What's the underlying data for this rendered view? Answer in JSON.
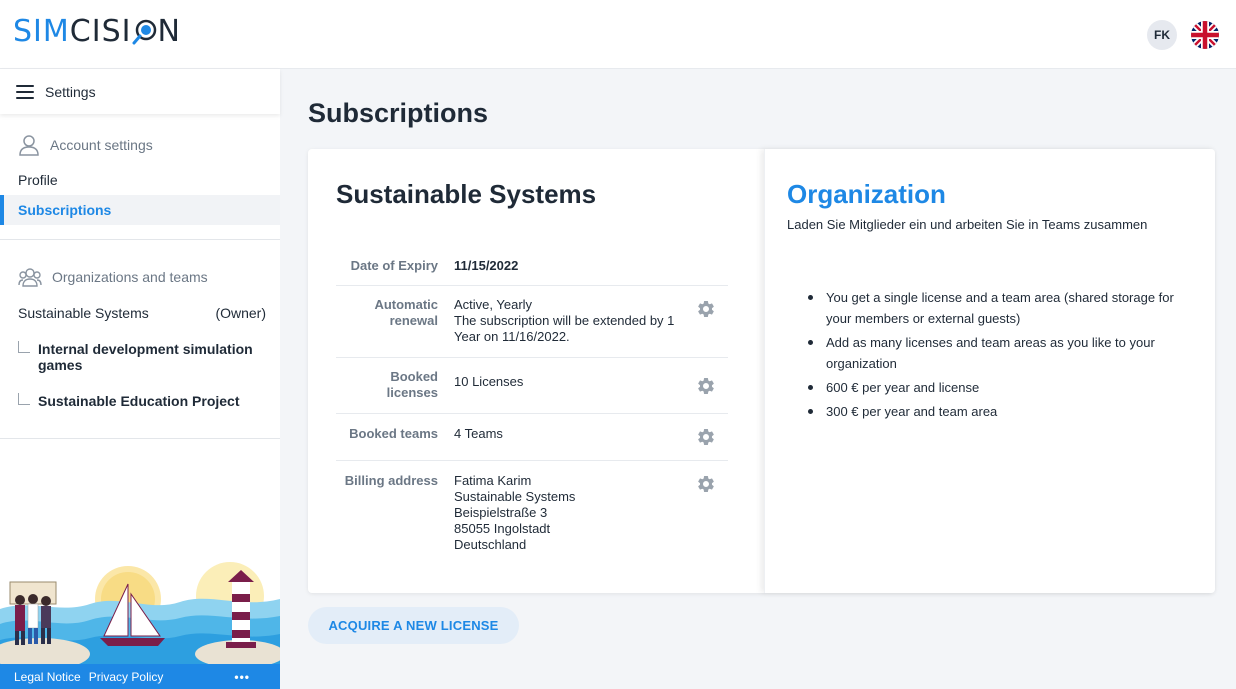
{
  "app": {
    "logo_part1": "SIM",
    "logo_part2": "CISI",
    "logo_part3": "N",
    "user_initials": "FK",
    "language_icon": "uk-flag-icon"
  },
  "sidebar": {
    "menu_label": "Settings",
    "account_section": "Account settings",
    "account_items": [
      {
        "label": "Profile",
        "active": false
      },
      {
        "label": "Subscriptions",
        "active": true
      }
    ],
    "org_section": "Organizations and teams",
    "org_name": "Sustainable Systems",
    "org_role": "(Owner)",
    "teams": [
      "Internal development simulation games",
      "Sustainable Education Project"
    ]
  },
  "footer": {
    "legal": "Legal Notice",
    "privacy": "Privacy Policy",
    "more": "•••"
  },
  "main": {
    "page_title": "Subscriptions",
    "subscription": {
      "name": "Sustainable Systems",
      "rows": [
        {
          "label": "Date of Expiry",
          "value": "11/15/2022"
        },
        {
          "label": "Automatic renewal",
          "value": "Active, Yearly\nThe subscription will be extended by 1 Year on 11/16/2022."
        },
        {
          "label": "Booked licenses",
          "value": "10 Licenses"
        },
        {
          "label": "Booked teams",
          "value": "4 Teams"
        },
        {
          "label": "Billing address",
          "value": "Fatima Karim\nSustainable Systems\nBeispielstraße 3\n85055 Ingolstadt\nDeutschland"
        }
      ]
    },
    "plan": {
      "title": "Organization",
      "subtitle": "Laden Sie Mitglieder ein und arbeiten Sie in Teams zusammen",
      "bullets": [
        "You get a single license and a team area (shared storage for your members or external guests)",
        "Add as many licenses and team areas as you like to your organization",
        "600 € per year and license",
        "300 € per year and team area"
      ]
    },
    "acquire_button": "ACQUIRE A NEW LICENSE"
  },
  "colors": {
    "accent": "#1e88e5",
    "text": "#1f2a37",
    "muted": "#6b7785",
    "background": "#f3f5f8"
  }
}
